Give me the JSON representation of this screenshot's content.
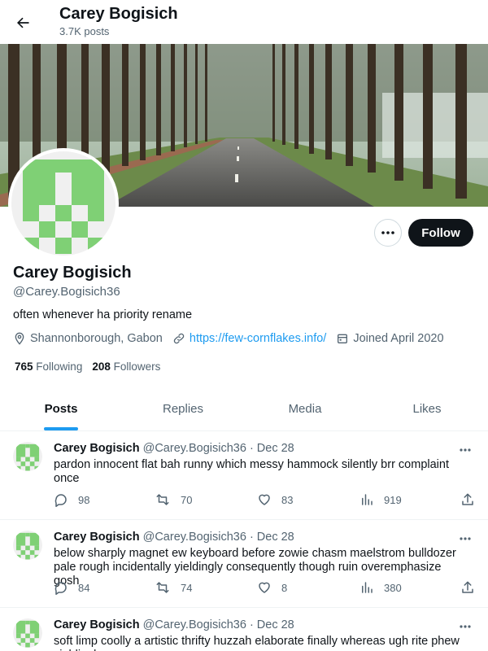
{
  "header": {
    "title": "Carey Bogisich",
    "posts_count": "3.7K posts"
  },
  "profile": {
    "name": "Carey Bogisich",
    "handle": "@Carey.Bogisich36",
    "bio": "often whenever ha priority rename",
    "location": "Shannonborough, Gabon",
    "website": "https://few-cornflakes.info/",
    "joined": "Joined April 2020",
    "following_count": "765",
    "following_label": "Following",
    "followers_count": "208",
    "followers_label": "Followers",
    "follow_label": "Follow",
    "avatar_color": "#7fd075"
  },
  "tabs": [
    {
      "label": "Posts"
    },
    {
      "label": "Replies"
    },
    {
      "label": "Media"
    },
    {
      "label": "Likes"
    }
  ],
  "posts": [
    {
      "name": "Carey Bogisich",
      "handle": "@Carey.Bogisich36",
      "date": "· Dec 28",
      "text": "pardon innocent flat bah runny which messy hammock silently brr complaint once",
      "replies": "98",
      "reposts": "70",
      "likes": "83",
      "views": "919"
    },
    {
      "name": "Carey Bogisich",
      "handle": "@Carey.Bogisich36",
      "date": "· Dec 28",
      "text": "below sharply magnet ew keyboard before zowie chasm maelstrom bulldozer pale rough incidentally yieldingly consequently though ruin overemphasize gosh",
      "replies": "84",
      "reposts": "74",
      "likes": "8",
      "views": "380"
    },
    {
      "name": "Carey Bogisich",
      "handle": "@Carey.Bogisich36",
      "date": "· Dec 28",
      "text": "soft limp coolly a artistic thrifty huzzah elaborate finally whereas ugh rite phew yieldingly",
      "replies": "",
      "reposts": "",
      "likes": "",
      "views": ""
    }
  ],
  "colors": {
    "accent": "#1d9bf0",
    "text": "#0f1419",
    "muted": "#536471"
  }
}
